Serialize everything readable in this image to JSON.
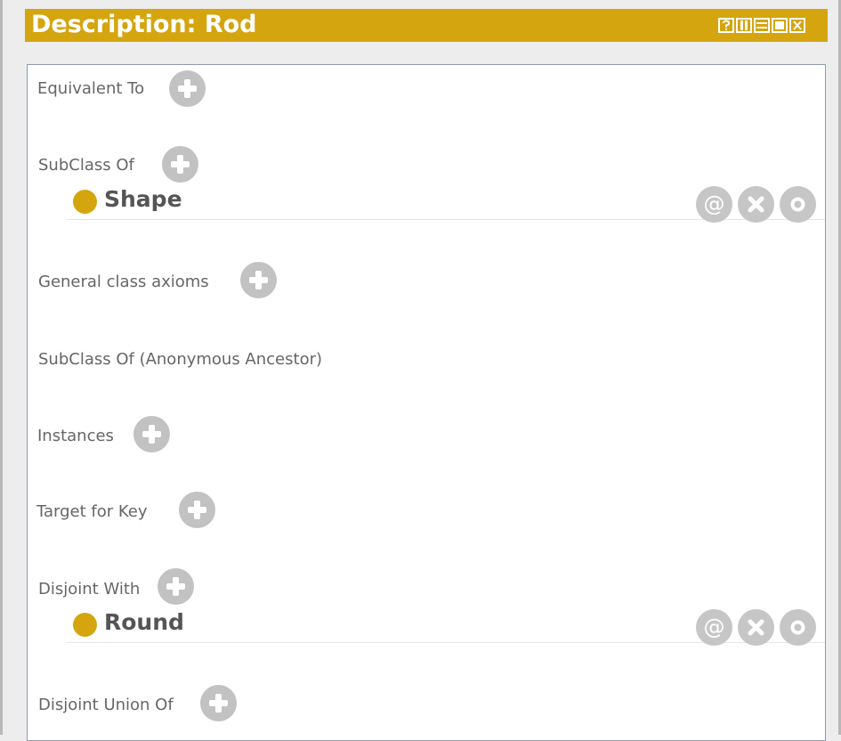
{
  "window": {
    "title": "Description: Rod",
    "buttons": [
      "help",
      "float",
      "minimize",
      "maximize",
      "close"
    ]
  },
  "sections": [
    {
      "label": "Equivalent To",
      "has_add": true
    },
    {
      "label": "SubClass Of",
      "has_add": true,
      "entries": [
        {
          "name": "Shape"
        }
      ]
    },
    {
      "label": "General class axioms",
      "has_add": true
    },
    {
      "label": "SubClass Of (Anonymous Ancestor)",
      "has_add": false
    },
    {
      "label": "Instances",
      "has_add": true
    },
    {
      "label": "Target for Key",
      "has_add": true
    },
    {
      "label": "Disjoint With",
      "has_add": true,
      "entries": [
        {
          "name": "Round"
        }
      ]
    },
    {
      "label": "Disjoint Union Of",
      "has_add": true
    }
  ],
  "entry_actions": {
    "annotate_label": "@",
    "icons": [
      "annotate-icon",
      "remove-icon",
      "edit-icon"
    ]
  },
  "colors": {
    "accent": "#d4a50f",
    "icon_gray": "#c2c2c2",
    "label_text": "#666666",
    "entry_text": "#555555"
  }
}
